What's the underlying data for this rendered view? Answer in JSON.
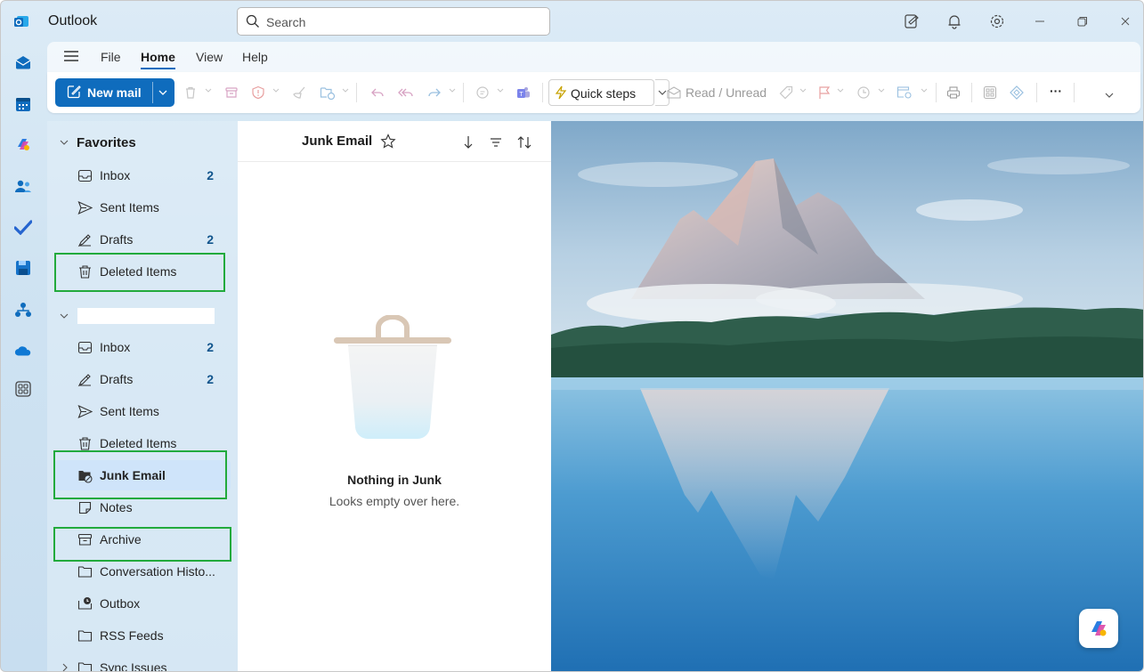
{
  "app": {
    "title": "Outlook"
  },
  "search": {
    "placeholder": "Search"
  },
  "menu": {
    "items": [
      {
        "label": "File",
        "active": false
      },
      {
        "label": "Home",
        "active": true
      },
      {
        "label": "View",
        "active": false
      },
      {
        "label": "Help",
        "active": false
      }
    ]
  },
  "toolbar": {
    "new_mail": "New mail",
    "quick_steps": "Quick steps",
    "read_unread": "Read / Unread",
    "more": "···"
  },
  "folders": {
    "favorites_label": "Favorites",
    "favorites": [
      {
        "label": "Inbox",
        "count": "2",
        "icon": "inbox-icon"
      },
      {
        "label": "Sent Items",
        "count": "",
        "icon": "send-icon"
      },
      {
        "label": "Drafts",
        "count": "2",
        "icon": "drafts-icon"
      },
      {
        "label": "Deleted Items",
        "count": "",
        "icon": "trash-icon"
      }
    ],
    "account_name": "",
    "account": [
      {
        "label": "Inbox",
        "count": "2",
        "icon": "inbox-icon"
      },
      {
        "label": "Drafts",
        "count": "2",
        "icon": "drafts-icon"
      },
      {
        "label": "Sent Items",
        "count": "",
        "icon": "send-icon"
      },
      {
        "label": "Deleted Items",
        "count": "",
        "icon": "trash-icon"
      },
      {
        "label": "Junk Email",
        "count": "",
        "icon": "junk-folder-icon",
        "selected": true
      },
      {
        "label": "Notes",
        "count": "",
        "icon": "notes-icon"
      },
      {
        "label": "Archive",
        "count": "",
        "icon": "archive-icon"
      },
      {
        "label": "Conversation Histo...",
        "count": "",
        "icon": "folder-icon"
      },
      {
        "label": "Outbox",
        "count": "",
        "icon": "outbox-icon"
      },
      {
        "label": "RSS Feeds",
        "count": "",
        "icon": "folder-icon"
      },
      {
        "label": "Sync Issues",
        "count": "",
        "icon": "folder-icon"
      }
    ]
  },
  "message_list": {
    "title": "Junk Email",
    "empty_title": "Nothing in Junk",
    "empty_subtitle": "Looks empty over here."
  },
  "colors": {
    "accent": "#0f6cbd",
    "highlight_box": "#22aa3c",
    "selected_bg": "#cfe4fa"
  }
}
